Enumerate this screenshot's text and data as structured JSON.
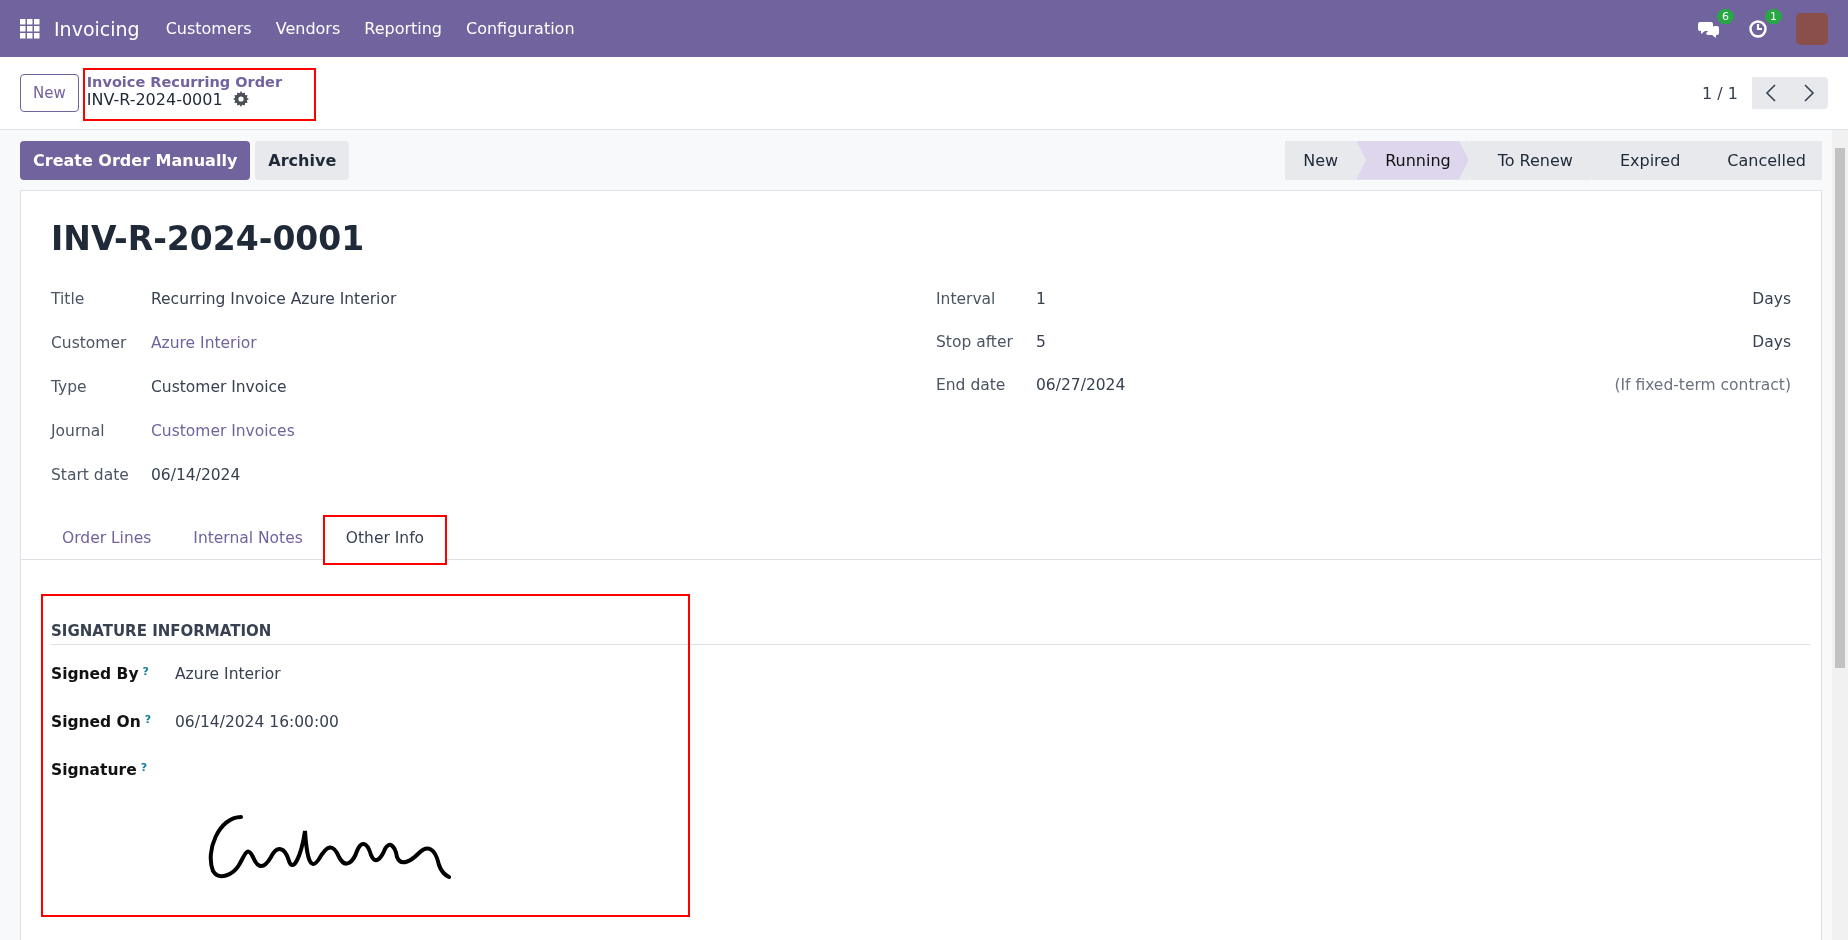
{
  "navbar": {
    "app": "Invoicing",
    "menus": [
      "Customers",
      "Vendors",
      "Reporting",
      "Configuration"
    ],
    "messages_badge": "6",
    "activities_badge": "1"
  },
  "control_panel": {
    "new_button": "New",
    "breadcrumb": {
      "parent": "Invoice Recurring Order",
      "current": "INV-R-2024-0001",
      "highlighted": true
    },
    "pager": "1 / 1"
  },
  "actions": [
    {
      "label": "Create Order Manually",
      "kind": "primary"
    },
    {
      "label": "Archive",
      "kind": "secondary"
    }
  ],
  "stages": [
    {
      "label": "New",
      "selected": false
    },
    {
      "label": "Running",
      "selected": true
    },
    {
      "label": "To Renew",
      "selected": false
    },
    {
      "label": "Expired",
      "selected": false
    },
    {
      "label": "Cancelled",
      "selected": false
    }
  ],
  "record": {
    "name": "INV-R-2024-0001",
    "left_fields": [
      {
        "label": "Title",
        "value": "Recurring Invoice Azure Interior",
        "link": false
      },
      {
        "label": "Customer",
        "value": "Azure Interior",
        "link": true
      },
      {
        "label": "Type",
        "value": "Customer Invoice",
        "link": false
      },
      {
        "label": "Journal",
        "value": "Customer Invoices",
        "link": true
      },
      {
        "label": "Start date",
        "value": "06/14/2024",
        "link": false
      }
    ],
    "right_fields": [
      {
        "label": "Interval",
        "value": "1",
        "unit": "Days"
      },
      {
        "label": "Stop after",
        "value": "5",
        "unit": "Days"
      },
      {
        "label": "End date",
        "value": "06/27/2024",
        "hint": "(If fixed-term contract)"
      }
    ]
  },
  "tabs": [
    {
      "label": "Order Lines",
      "selected": false,
      "highlighted": false
    },
    {
      "label": "Internal Notes",
      "selected": false,
      "highlighted": false
    },
    {
      "label": "Other Info",
      "selected": true,
      "highlighted": true
    }
  ],
  "signature_section": {
    "title": "SIGNATURE INFORMATION",
    "highlighted": true,
    "fields": [
      {
        "label": "Signed By",
        "help": "?",
        "kind": "text",
        "value": "Azure Interior"
      },
      {
        "label": "Signed On",
        "help": "?",
        "kind": "text",
        "value": "06/14/2024 16:00:00"
      },
      {
        "label": "Signature",
        "help": "?",
        "kind": "signature"
      }
    ]
  }
}
